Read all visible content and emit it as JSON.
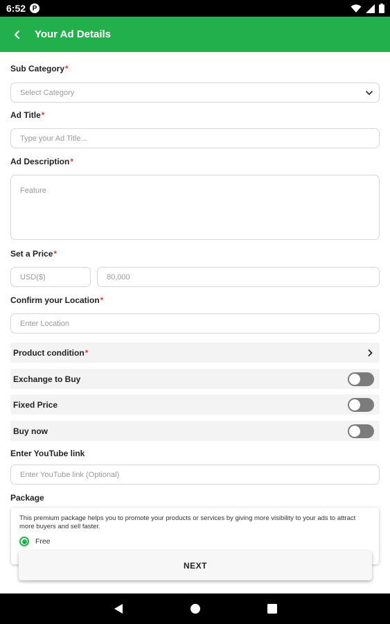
{
  "status_bar": {
    "time": "6:52",
    "badge": "P"
  },
  "app_bar": {
    "title": "Your Ad Details"
  },
  "form": {
    "sub_category": {
      "label": "Sub Category",
      "required": "*",
      "placeholder": "Select Category"
    },
    "ad_title": {
      "label": "Ad Title",
      "required": "*",
      "placeholder": "Type your Ad Title..."
    },
    "ad_description": {
      "label": "Ad Description",
      "required": "*",
      "placeholder": "Feature"
    },
    "price": {
      "label": "Set a Price",
      "required": "*",
      "currency": "USD($)",
      "amount_placeholder": "80,000"
    },
    "location": {
      "label": "Confirm your Location",
      "required": "*",
      "placeholder": "Enter Location"
    },
    "product_condition": {
      "label": "Product condition",
      "required": "*"
    },
    "exchange_to_buy": {
      "label": "Exchange to Buy",
      "on": false
    },
    "fixed_price": {
      "label": "Fixed Price",
      "on": false
    },
    "buy_now": {
      "label": "Buy now",
      "on": false
    },
    "youtube": {
      "label": "Enter YouTube link",
      "placeholder": "Enter YouTube link (Optional)"
    },
    "package": {
      "label": "Package",
      "description": "This premium package helps you to promote your products or services by giving more visibility to your ads to attract more buyers and sell faster.",
      "option_label": "Free",
      "selected": true
    }
  },
  "buttons": {
    "next": "NEXT"
  },
  "colors": {
    "brand_green": "#21b04b",
    "required_red": "#e53935"
  }
}
